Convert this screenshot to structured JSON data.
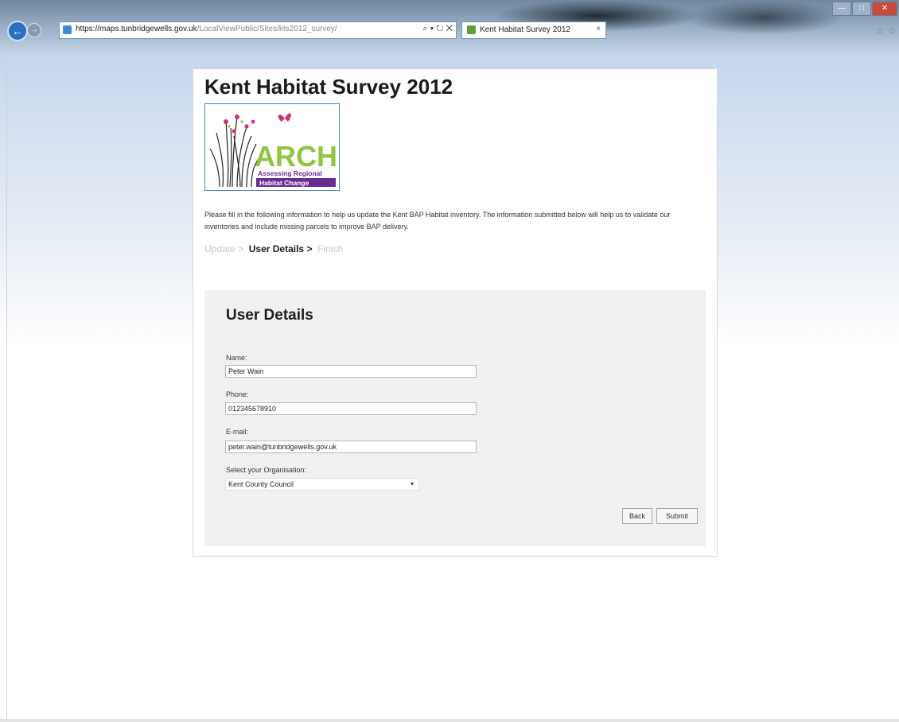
{
  "browser": {
    "url_host": "https://maps.tunbridgewells.gov.uk",
    "url_path": "/LocalViewPublic/Sites/kts2012_survey/",
    "addr_icons": "⌕ ▾ ↻ ✕",
    "tab_title": "Kent Habitat Survey 2012",
    "tab_close": "×",
    "win_min": "—",
    "win_max": "□",
    "win_close": "✕",
    "back_glyph": "←",
    "forward_glyph": "→",
    "home_glyph": "⌂",
    "favorites_glyph": "☆"
  },
  "page": {
    "title": "Kent Habitat Survey 2012",
    "logo": {
      "word": "ARCH",
      "line1": "Assessing Regional",
      "line2": "Habitat Change"
    },
    "intro": "Please fill in the following information to help us update the Kent BAP Habitat inventory. The information submitted below will help us to validate our inventories and include missing parcels to improve BAP delivery.",
    "steps": [
      {
        "label": "Update",
        "sep": ">"
      },
      {
        "label": "User Details",
        "sep": ">"
      },
      {
        "label": "Finish",
        "sep": ""
      }
    ]
  },
  "form": {
    "heading": "User Details",
    "name_label": "Name:",
    "name_value": "Peter Wain",
    "phone_label": "Phone:",
    "phone_value": "012345678910",
    "email_label": "E-mail:",
    "email_value": "peter.wain@tunbridgewells.gov.uk",
    "org_label": "Select your Organisation:",
    "org_value": "Kent County Council",
    "org_arrow": "▾",
    "back_label": "Back",
    "submit_label": "Submit"
  },
  "colors": {
    "logo_green": "#8dc63f",
    "logo_purple": "#6a2c91",
    "accent_blue": "#2a6fc0"
  }
}
